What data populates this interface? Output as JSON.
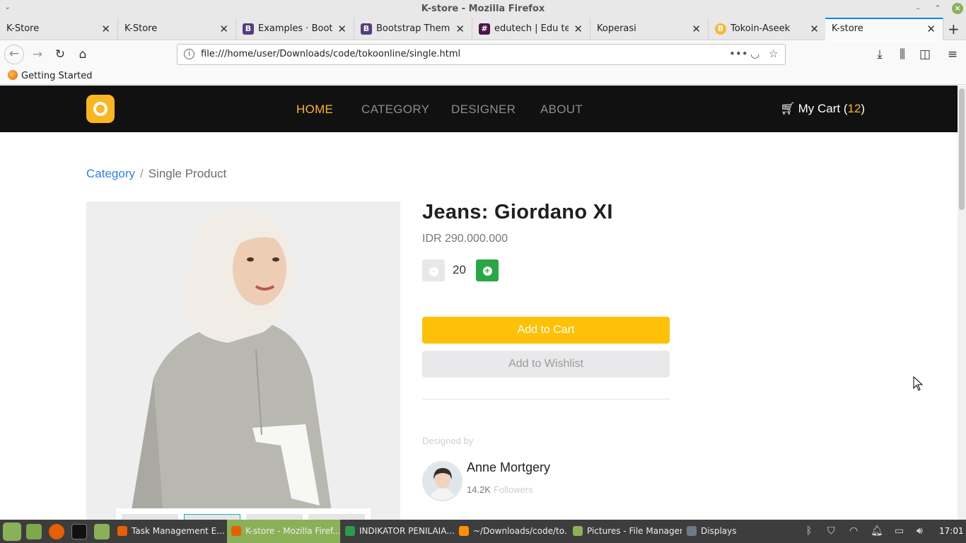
{
  "window": {
    "title": "K-store - Mozilla Firefox"
  },
  "tabs": [
    {
      "label": "K-Store"
    },
    {
      "label": "K-Store"
    },
    {
      "label": "Examples · Bootstrap",
      "favicon": "B",
      "favicon_color": "#563d7c"
    },
    {
      "label": "Bootstrap Themes",
      "favicon": "B",
      "favicon_color": "#563d7c"
    },
    {
      "label": "edutech | Edu tech",
      "favicon": "#",
      "favicon_color": "#4a154b"
    },
    {
      "label": "Koperasi"
    },
    {
      "label": "Tokoin-Aseek",
      "favicon": "B",
      "favicon_color": "#f7b731"
    },
    {
      "label": "K-store",
      "active": true
    }
  ],
  "urlbar": {
    "url": "file:///home/user/Downloads/code/tokoonline/single.html"
  },
  "bookmarks": {
    "item": "Getting Started"
  },
  "site": {
    "menu": {
      "home": "HOME",
      "category": "CATEGORY",
      "designer": "DESIGNER",
      "about": "ABOUT"
    },
    "cart": {
      "label": "My Cart (",
      "count": "12",
      "close": ")"
    },
    "breadcrumb": {
      "link": "Category",
      "separator": "/",
      "current": "Single Product"
    },
    "product": {
      "title": "Jeans: Giordano XI",
      "price": "IDR 290.000.000",
      "quantity": "20",
      "add_to_cart": "Add to Cart",
      "add_to_wishlist": "Add to Wishlist"
    },
    "designer": {
      "designed_by": "Designed by",
      "name": "Anne Mortgery",
      "followers_count": "14.2K",
      "followers_label": "Followers"
    },
    "colors": {
      "accent": "#fbb521",
      "header_bg": "#111111",
      "plus_button": "#28a745",
      "add_to_cart_bg": "#ffc107"
    }
  },
  "taskbar": {
    "tasks": [
      {
        "label": "Task Management E..."
      },
      {
        "label": "K-store - Mozilla Firef...",
        "active": true
      },
      {
        "label": "INDIKATOR PENILAIA..."
      },
      {
        "label": "~/Downloads/code/to..."
      },
      {
        "label": "Pictures - File Manager"
      },
      {
        "label": "Displays"
      }
    ],
    "clock": "17:01"
  }
}
